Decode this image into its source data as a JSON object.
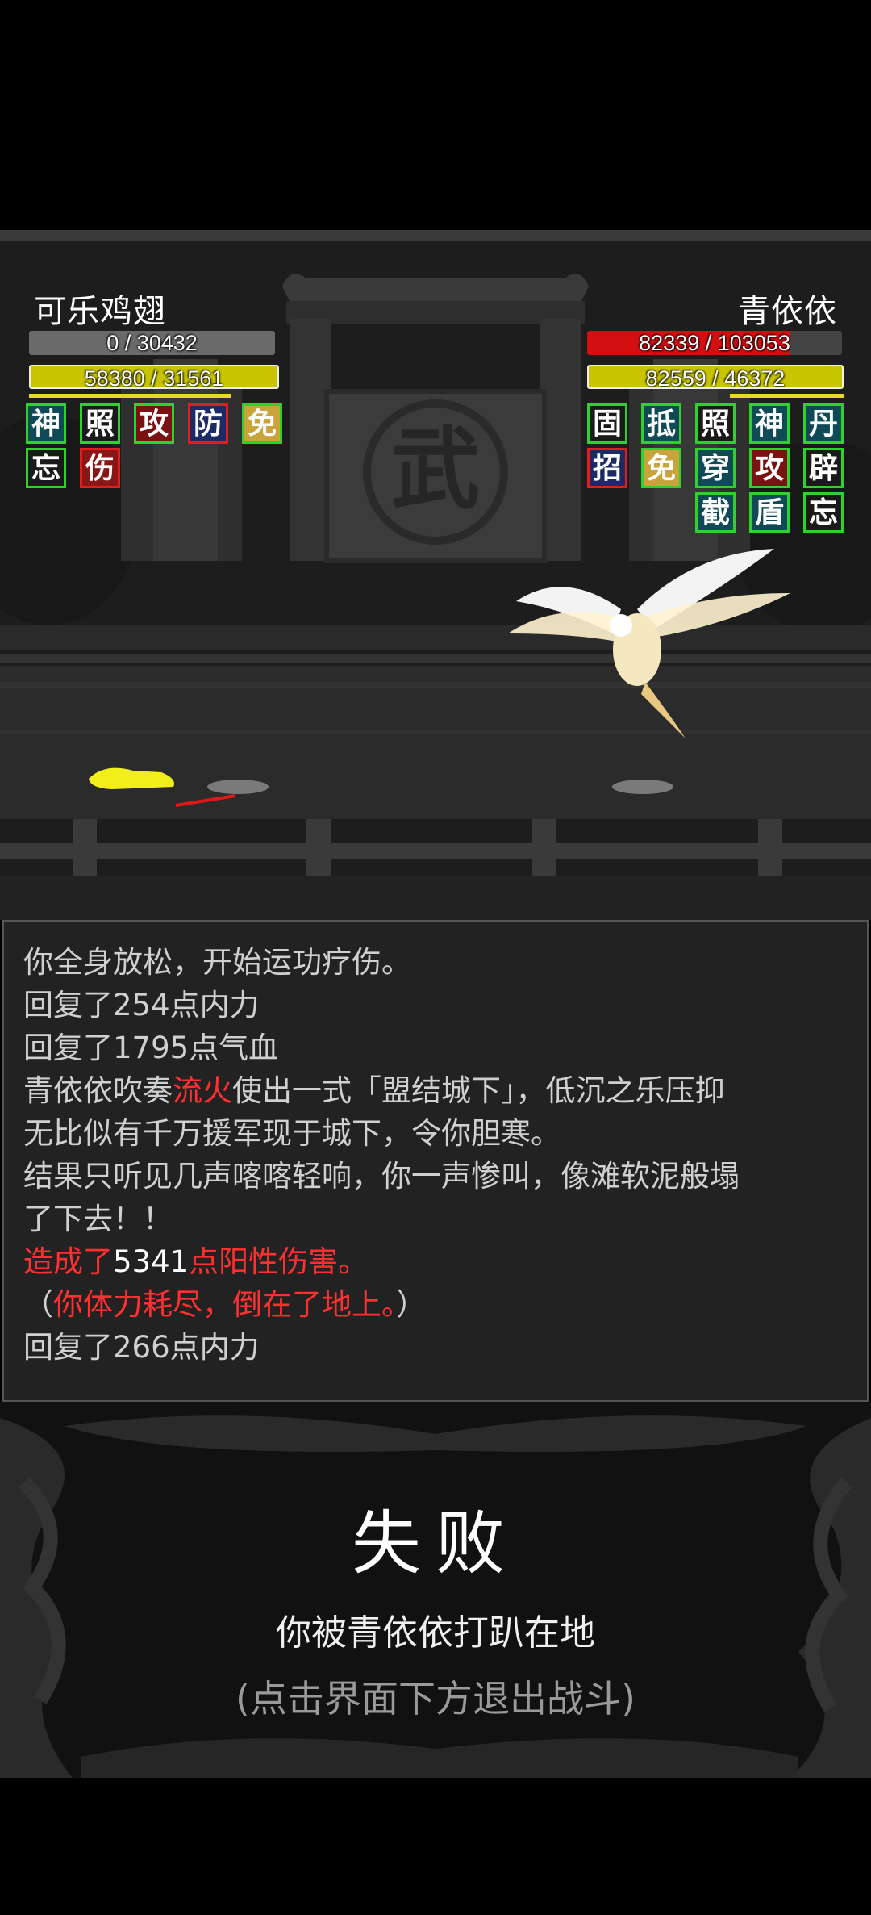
{
  "player": {
    "name": "可乐鸡翅",
    "hp_text": "0 / 30432",
    "mp_text": "58380 / 31561",
    "hp_fraction": 0,
    "buffs_row1": [
      "神",
      "照",
      "攻",
      "防",
      "免"
    ],
    "buffs_row2": [
      "忘",
      "伤"
    ]
  },
  "enemy": {
    "name": "青依依",
    "hp_text": "82339 / 103053",
    "mp_text": "82559 / 46372",
    "hp_fraction": 0.799,
    "buffs_row1": [
      "固",
      "抵",
      "照",
      "神",
      "丹"
    ],
    "buffs_row2": [
      "招",
      "免",
      "穿",
      "攻",
      "辟"
    ],
    "buffs_row3": [
      "截",
      "盾",
      "忘"
    ]
  },
  "scene": {
    "banner_char": "武"
  },
  "log": {
    "l1": "你全身放松，开始运功疗伤。",
    "l2": "回复了254点内力",
    "l3": "回复了1795点气血",
    "l4a": "青依依吹奏",
    "l4b": "流火",
    "l4c": "使出一式「盟结城下」，低沉之乐压抑",
    "l5": "无比似有千万援军现于城下，令你胆寒。",
    "l6": "结果只听见几声喀喀轻响，你一声惨叫，像滩软泥般塌",
    "l7": "了下去！！",
    "l8a": "造成了",
    "l8b": "5341",
    "l8c": "点阳性伤害。",
    "l9a": "（",
    "l9b": "你体力耗尽，倒在了地上。",
    "l9c": "）",
    "l10": "回复了266点内力"
  },
  "result": {
    "title": "失败",
    "message": "你被青依依打趴在地",
    "hint": "(点击界面下方退出战斗)"
  }
}
